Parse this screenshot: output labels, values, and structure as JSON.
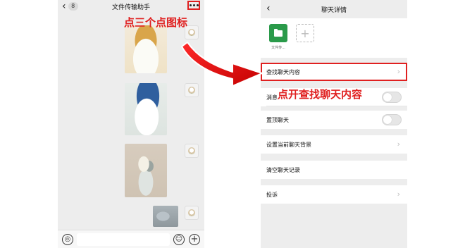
{
  "chat": {
    "back_glyph": "‹",
    "unread_count": "8",
    "title": "文件传输助手",
    "more_icon": "more-dots-icon",
    "voice_glyph": "◎",
    "emoji_glyph": "☺",
    "plus_glyph": "+"
  },
  "annotations": {
    "step1": "点三个点图标",
    "step2": "点开查找聊天内容",
    "color": "#e02020"
  },
  "details": {
    "back_glyph": "‹",
    "title": "聊天详情",
    "member_label": "文件传...",
    "add_glyph": "+",
    "chevron": "›",
    "rows": {
      "search": "查找聊天内容",
      "mute": "消息",
      "pin": "置顶聊天",
      "background": "设置当前聊天背景",
      "clear": "清空聊天记录",
      "report": "投诉"
    },
    "mute_toggle": "off",
    "pin_toggle": "off"
  }
}
